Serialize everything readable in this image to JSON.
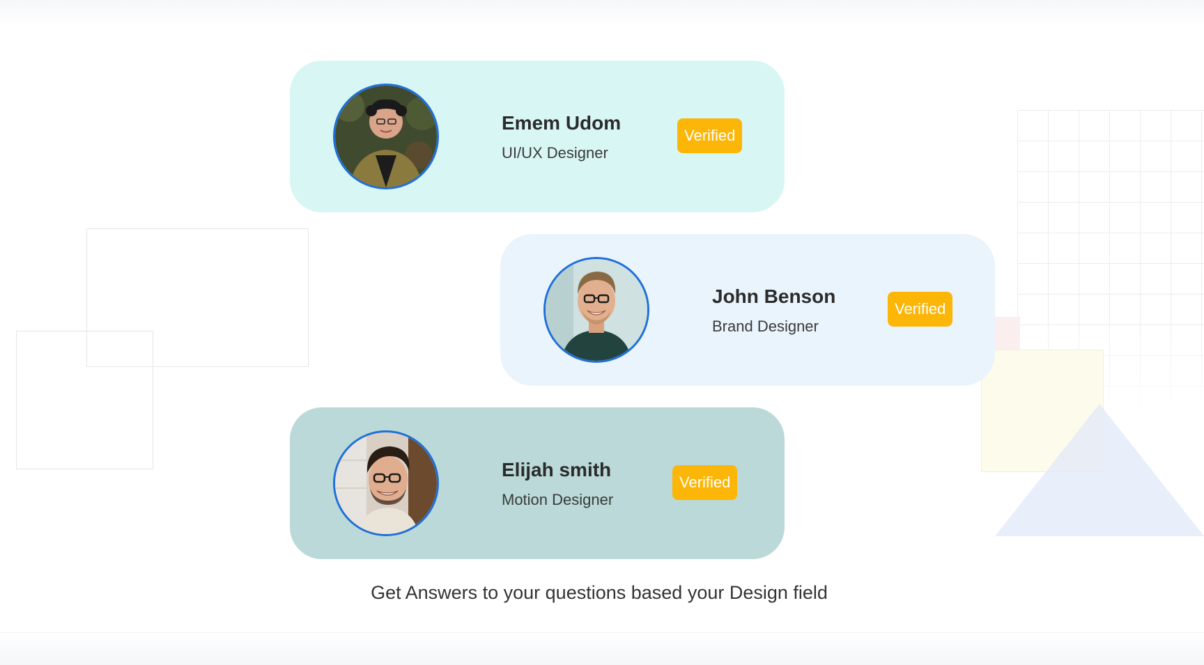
{
  "profiles": [
    {
      "name": "Emem Udom",
      "role": "UI/UX Designer",
      "badge": "Verified"
    },
    {
      "name": "John Benson",
      "role": "Brand Designer",
      "badge": "Verified"
    },
    {
      "name": "Elijah smith",
      "role": "Motion Designer",
      "badge": "Verified"
    }
  ],
  "tagline": "Get Answers to your questions based your Design field",
  "colors": {
    "card_1_bg": "#d8f6f4",
    "card_2_bg": "#eaf4fc",
    "card_3_bg": "#bad9d8",
    "badge_bg": "#fbb607",
    "avatar_ring": "#1e6fd9"
  },
  "icons": [
    "avatar-emem-udom",
    "avatar-john-benson",
    "avatar-elijah-smith"
  ]
}
